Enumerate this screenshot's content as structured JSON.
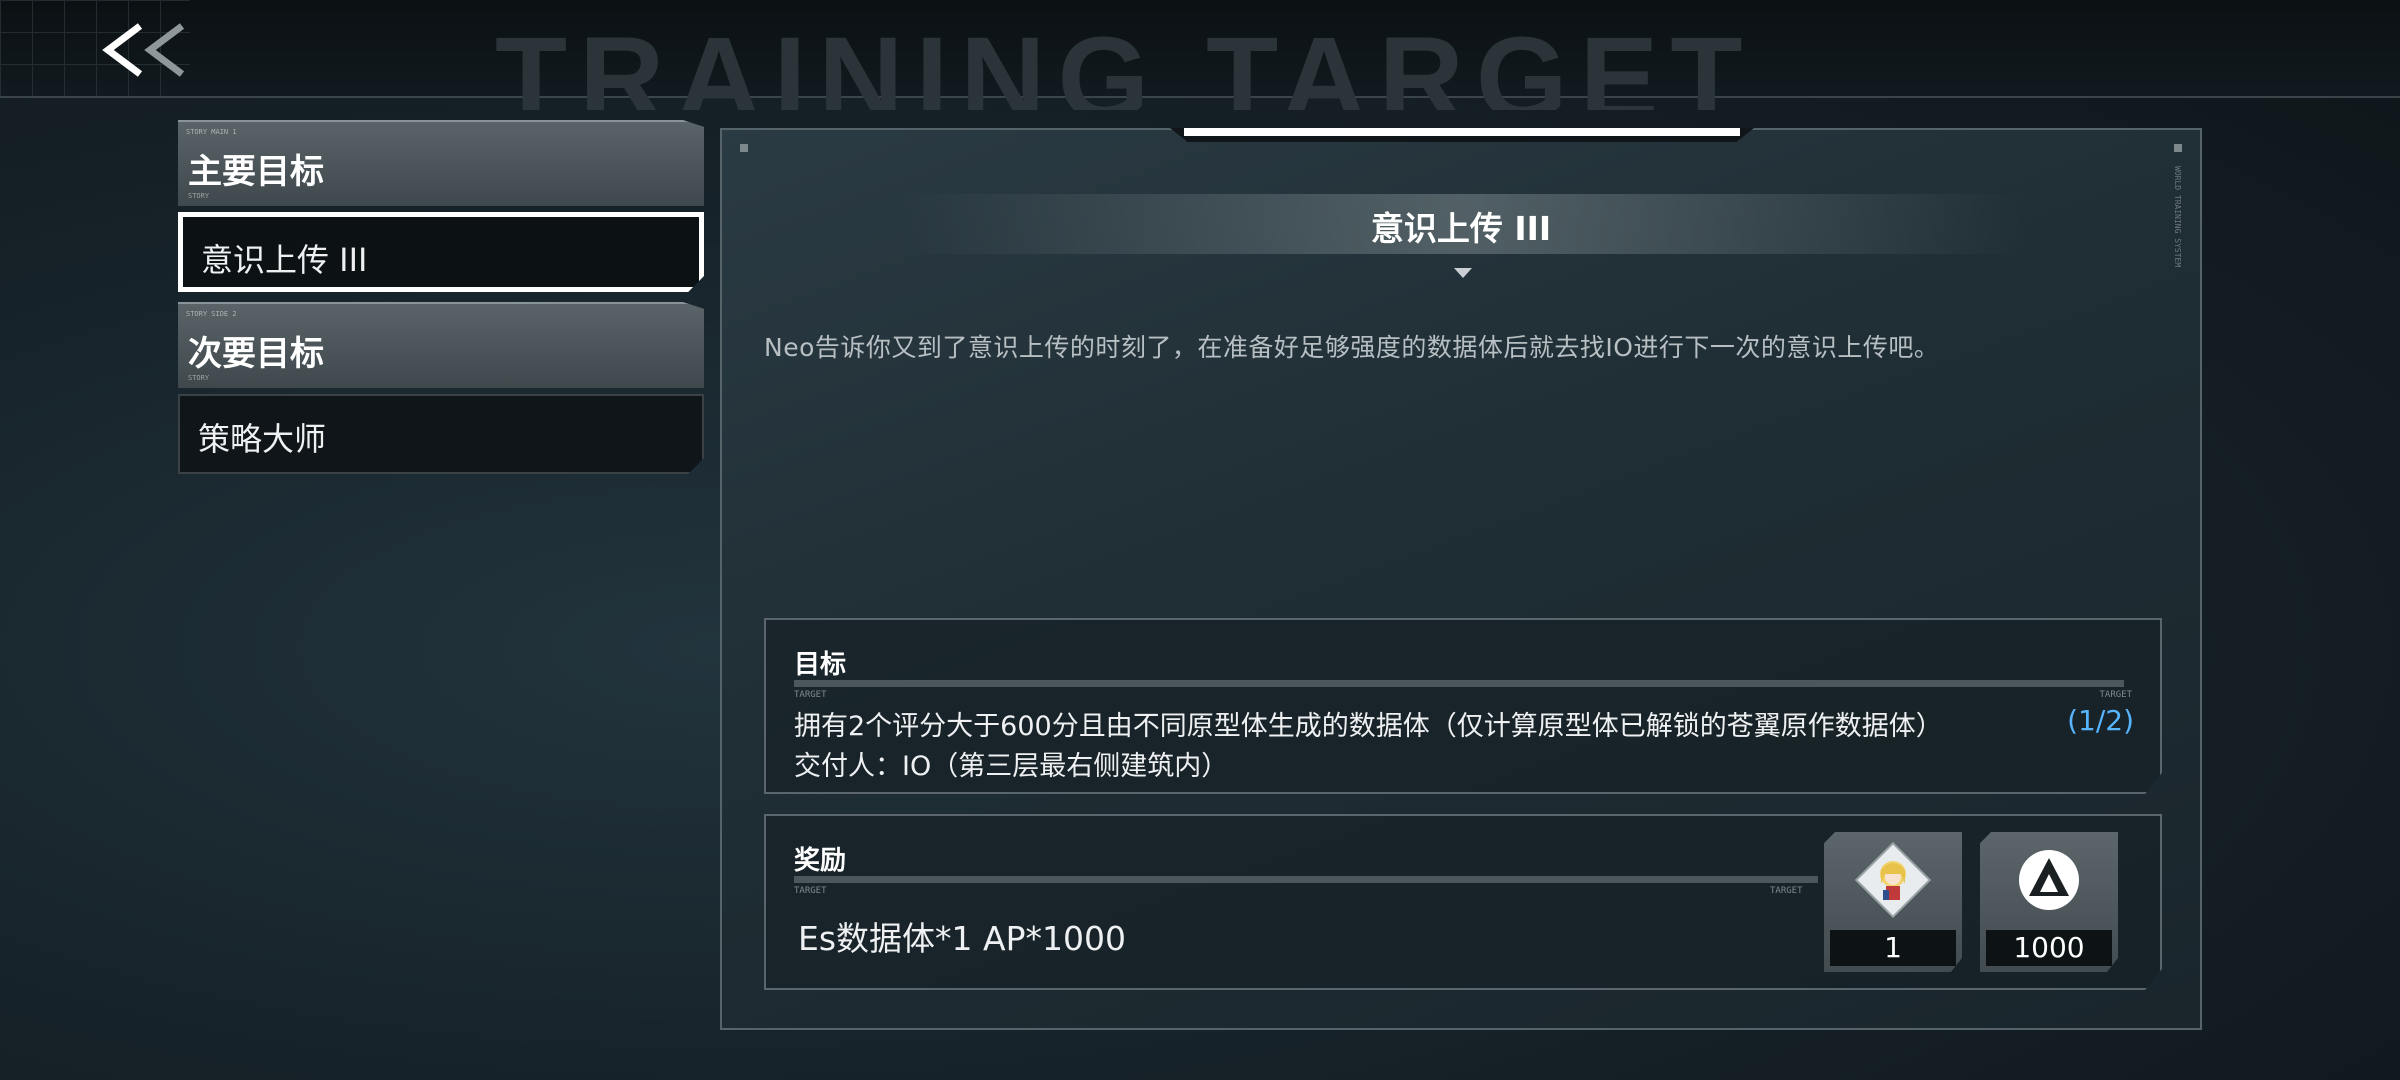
{
  "header": {
    "back_label": "<<",
    "watermark": "TRAINING TARGET"
  },
  "menu": {
    "sections": [
      {
        "header": "主要目标",
        "tiny_top": "STORY MAIN 1",
        "tiny_bottom": "STORY",
        "items": [
          {
            "label": "意识上传 III",
            "active": true
          }
        ]
      },
      {
        "header": "次要目标",
        "tiny_top": "STORY SIDE 2",
        "tiny_bottom": "STORY",
        "items": [
          {
            "label": "策略大师",
            "active": false
          }
        ]
      }
    ]
  },
  "quest": {
    "title": "意识上传 III",
    "description": "Neo告诉你又到了意识上传的时刻了，在准备好足够强度的数据体后就去找IO进行下一次的意识上传吧。",
    "side_text": "WORLD TRAINING SYSTEM",
    "goal": {
      "title": "目标",
      "tag_left": "TARGET",
      "tag_right": "TARGET",
      "text": "拥有2个评分大于600分且由不同原型体生成的数据体（仅计算原型体已解锁的苍翼原作数据体）",
      "progress": "(1/2)",
      "deliver": "交付人：IO（第三层最右侧建筑内）"
    },
    "reward": {
      "title": "奖励",
      "tag_left": "TARGET",
      "tag_right": "TARGET",
      "text": "Es数据体*1  AP*1000",
      "items": [
        {
          "icon": "character-portrait-icon",
          "count": "1"
        },
        {
          "icon": "ap-currency-icon",
          "count": "1000"
        }
      ]
    }
  },
  "colors": {
    "progress_accent": "#58b4ff",
    "active_border": "#ffffff"
  }
}
